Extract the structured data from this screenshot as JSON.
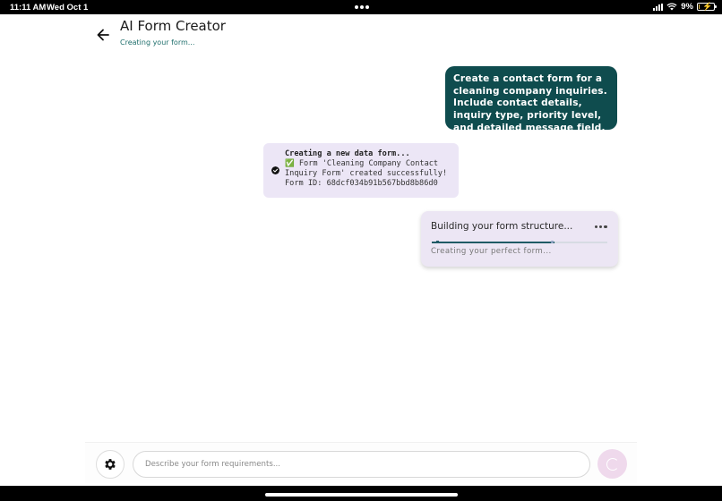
{
  "status_bar": {
    "time": "11:11 AM",
    "date": "Wed Oct 1",
    "battery": "9%",
    "battery_level": 0.09
  },
  "header": {
    "title": "AI Form Creator",
    "subtitle": "Creating your form..."
  },
  "messages": {
    "user_prompt": "Create a contact form for a cleaning company inquiries. Include contact details, inquiry type,  priority level, and detailed message field.",
    "system_title": "Creating a new data form...",
    "system_body": "✅ Form 'Cleaning Company Contact Inquiry Form' created successfully! Form ID: 68dcf034b91b567bbd8b86d0",
    "progress_title": "Building your form structure...",
    "progress_subtitle": "Creating your perfect form...",
    "progress_fraction": 0.7
  },
  "input": {
    "placeholder": "Describe your form requirements..."
  },
  "icons": {
    "back": "arrow-left-icon",
    "settings": "gear-icon",
    "send": "loading-spinner-icon",
    "check": "check-circle-icon",
    "more": "more-horizontal-icon"
  },
  "colors": {
    "user_bubble": "#0f4c4e",
    "system_bubble": "#ece6f6",
    "accent_teal": "#1f6f6c",
    "send_button": "#efd9ec"
  }
}
